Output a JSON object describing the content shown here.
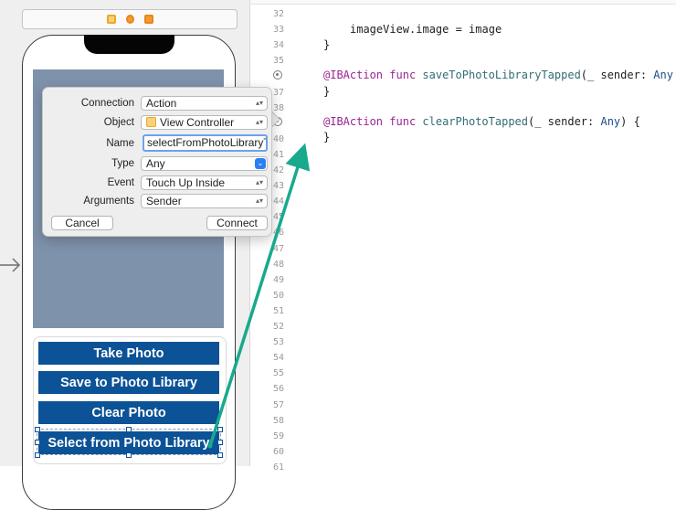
{
  "connection_dialog": {
    "labels": {
      "connection": "Connection",
      "object": "Object",
      "name": "Name",
      "type": "Type",
      "event": "Event",
      "arguments": "Arguments"
    },
    "values": {
      "connection": "Action",
      "object": "View Controller",
      "name": "selectFromPhotoLibraryT",
      "type": "Any",
      "event": "Touch Up Inside",
      "arguments": "Sender"
    },
    "cancel_label": "Cancel",
    "connect_label": "Connect"
  },
  "buttons": {
    "take_photo": "Take Photo",
    "save_to_photo_library": "Save to Photo Library",
    "clear_photo": "Clear Photo",
    "select_from_photo_library": "Select from Photo Library"
  },
  "code": {
    "lines": [
      {
        "n": "32",
        "text": ""
      },
      {
        "n": "33",
        "text": "imageView.image = image"
      },
      {
        "n": "34",
        "text": "}"
      },
      {
        "n": "35",
        "text": ""
      },
      {
        "n": "",
        "text": "@IBAction func saveToPhotoLibraryTapped(_ sender: Any"
      },
      {
        "n": "37",
        "text": "}"
      },
      {
        "n": "38",
        "text": ""
      },
      {
        "n": "",
        "text": "@IBAction func clearPhotoTapped(_ sender: Any) {"
      },
      {
        "n": "40",
        "text": "}"
      },
      {
        "n": "41",
        "text": ""
      },
      {
        "n": "42",
        "text": ""
      },
      {
        "n": "43",
        "text": ""
      },
      {
        "n": "44",
        "text": ""
      },
      {
        "n": "45",
        "text": ""
      },
      {
        "n": "46",
        "text": ""
      },
      {
        "n": "47",
        "text": ""
      },
      {
        "n": "48",
        "text": ""
      },
      {
        "n": "49",
        "text": ""
      },
      {
        "n": "50",
        "text": ""
      },
      {
        "n": "51",
        "text": ""
      },
      {
        "n": "52",
        "text": ""
      },
      {
        "n": "53",
        "text": ""
      },
      {
        "n": "54",
        "text": ""
      },
      {
        "n": "55",
        "text": ""
      },
      {
        "n": "56",
        "text": ""
      },
      {
        "n": "57",
        "text": ""
      },
      {
        "n": "58",
        "text": ""
      },
      {
        "n": "59",
        "text": ""
      },
      {
        "n": "60",
        "text": ""
      },
      {
        "n": "61",
        "text": ""
      }
    ]
  },
  "icons": {
    "dock": [
      "view-controller-icon",
      "first-responder-icon",
      "exit-icon"
    ],
    "entry": "entry-point-arrow-icon",
    "connection": "connection-circle-icon"
  },
  "colors": {
    "button_bg": "#0c5296",
    "image_view_bg": "#7f92ab",
    "drag_line": "#19a98c",
    "keyword": "#9b2393",
    "function_name": "#326d74",
    "type_name": "#1c4c8a",
    "name_field_focus": "#6aa2ee"
  }
}
